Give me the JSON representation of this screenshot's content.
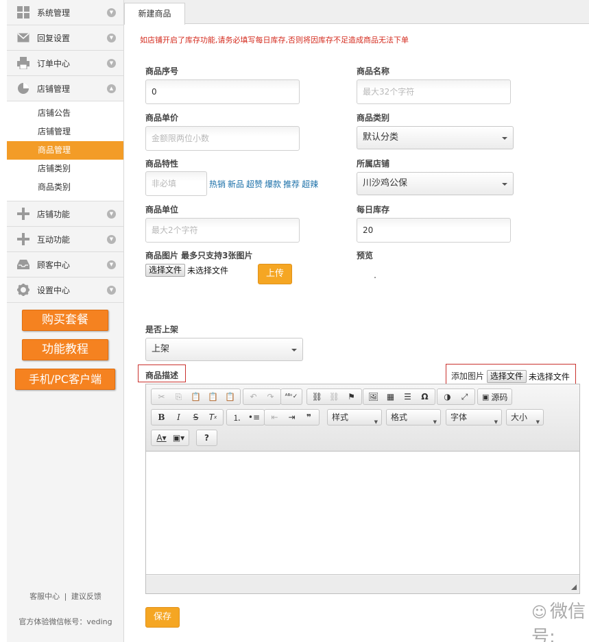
{
  "sidebar": {
    "menu": [
      {
        "label": "系统管理",
        "icon": "grid-icon"
      },
      {
        "label": "回复设置",
        "icon": "envelope-icon"
      },
      {
        "label": "订单中心",
        "icon": "printer-icon"
      },
      {
        "label": "店铺管理",
        "icon": "pie-chart-icon"
      }
    ],
    "submenu": [
      {
        "label": "店铺公告",
        "active": false
      },
      {
        "label": "店铺管理",
        "active": false
      },
      {
        "label": "商品管理",
        "active": true
      },
      {
        "label": "店铺类别",
        "active": false
      },
      {
        "label": "商品类别",
        "active": false
      }
    ],
    "menu2": [
      {
        "label": "店铺功能",
        "icon": "plus-icon"
      },
      {
        "label": "互动功能",
        "icon": "plus-icon"
      },
      {
        "label": "顾客中心",
        "icon": "inbox-icon"
      },
      {
        "label": "设置中心",
        "icon": "gear-icon"
      }
    ],
    "buttons": {
      "buy": "购买套餐",
      "tutorial": "功能教程",
      "client": "手机/PC客户端"
    },
    "footer": {
      "service": "客服中心",
      "separator": "|",
      "feedback": "建议反馈",
      "account": "官方体验微信帐号：veding"
    }
  },
  "tab": {
    "title": "新建商品"
  },
  "warning": "如店铺开启了库存功能,请务必填写每日库存,否则将因库存不足造成商品无法下单",
  "form": {
    "product_no": {
      "label": "商品序号",
      "value": "0"
    },
    "product_name": {
      "label": "商品名称",
      "placeholder": "最大32个字符"
    },
    "unit_price": {
      "label": "商品单价",
      "placeholder": "金额限两位小数"
    },
    "category": {
      "label": "商品类别",
      "value": "默认分类"
    },
    "feature": {
      "label": "商品特性",
      "placeholder": "非必填",
      "tags": [
        "热销",
        "新品",
        "超赞",
        "爆款",
        "推荐",
        "超辣"
      ]
    },
    "shop": {
      "label": "所属店铺",
      "value": "川沙鸡公保"
    },
    "unit": {
      "label": "商品单位",
      "placeholder": "最大2个字符"
    },
    "daily_stock": {
      "label": "每日库存",
      "value": "20"
    },
    "image": {
      "label": "商品图片 最多只支持3张图片",
      "file_button": "选择文件",
      "file_status": "未选择文件",
      "upload": "上传"
    },
    "preview": {
      "label": "预览"
    },
    "on_shelf": {
      "label": "是否上架",
      "value": "上架"
    },
    "description": {
      "label": "商品描述",
      "add_image": "添加图片",
      "file_button": "选择文件",
      "file_status": "未选择文件"
    },
    "save": "保存"
  },
  "editor": {
    "source_label": "源码",
    "style_label": "样式",
    "format_label": "格式",
    "font_label": "字体",
    "size_label": "大小",
    "help_label": "?"
  },
  "watermark": "微信号: veding"
}
